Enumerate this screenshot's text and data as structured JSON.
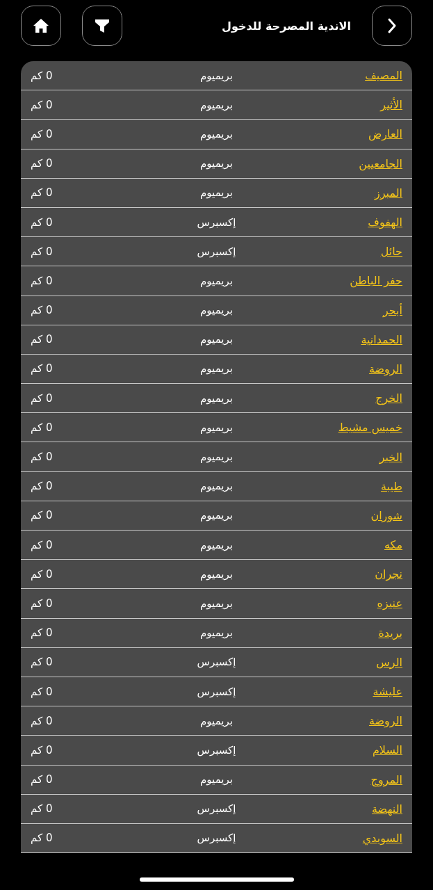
{
  "header": {
    "title": "الاندية المصرحة للدخول"
  },
  "rows": [
    {
      "name": "المصيف",
      "tier": "بريميوم",
      "distance": "0 كم"
    },
    {
      "name": "الأثير",
      "tier": "بريميوم",
      "distance": "0 كم"
    },
    {
      "name": "العارض",
      "tier": "بريميوم",
      "distance": "0 كم"
    },
    {
      "name": "الجامعيين",
      "tier": "بريميوم",
      "distance": "0 كم"
    },
    {
      "name": "المبرز",
      "tier": "بريميوم",
      "distance": "0 كم"
    },
    {
      "name": "الهفوف",
      "tier": "إكسبرس",
      "distance": "0 كم"
    },
    {
      "name": "حائل",
      "tier": "إكسبرس",
      "distance": "0 كم"
    },
    {
      "name": "حفر الباطن",
      "tier": "بريميوم",
      "distance": "0 كم"
    },
    {
      "name": "أبحر",
      "tier": "بريميوم",
      "distance": "0 كم"
    },
    {
      "name": "الحمدانية",
      "tier": "بريميوم",
      "distance": "0 كم"
    },
    {
      "name": "الروضة",
      "tier": "بريميوم",
      "distance": "0 كم"
    },
    {
      "name": "الخرج",
      "tier": "بريميوم",
      "distance": "0 كم"
    },
    {
      "name": "خميس مشيط",
      "tier": "بريميوم",
      "distance": "0 كم"
    },
    {
      "name": "الخبر",
      "tier": "بريميوم",
      "distance": "0 كم"
    },
    {
      "name": "طيبة",
      "tier": "بريميوم",
      "distance": "0 كم"
    },
    {
      "name": "شوران",
      "tier": "بريميوم",
      "distance": "0 كم"
    },
    {
      "name": "مكه",
      "tier": "بريميوم",
      "distance": "0 كم"
    },
    {
      "name": "نجران",
      "tier": "بريميوم",
      "distance": "0 كم"
    },
    {
      "name": "عنيزه",
      "tier": "بريميوم",
      "distance": "0 كم"
    },
    {
      "name": "بريدة",
      "tier": "بريميوم",
      "distance": "0 كم"
    },
    {
      "name": "الرس",
      "tier": "إكسبرس",
      "distance": "0 كم"
    },
    {
      "name": "عليشة",
      "tier": "إكسبرس",
      "distance": "0 كم"
    },
    {
      "name": "الروضة",
      "tier": "بريميوم",
      "distance": "0 كم"
    },
    {
      "name": "السلام",
      "tier": "إكسبرس",
      "distance": "0 كم"
    },
    {
      "name": "المروج",
      "tier": "بريميوم",
      "distance": "0 كم"
    },
    {
      "name": "النهضة",
      "tier": "إكسبرس",
      "distance": "0 كم"
    },
    {
      "name": "السويدي",
      "tier": "إكسبرس",
      "distance": "0 كم"
    }
  ]
}
